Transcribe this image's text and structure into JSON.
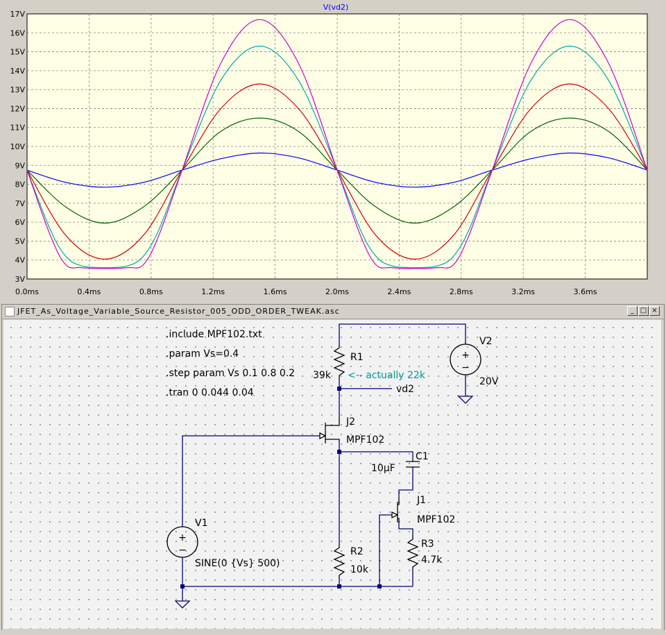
{
  "plot": {
    "trace_title": "V(vd2)",
    "trace_title_color": "#0000ff",
    "background": "#ffffe6",
    "grid_color": "#808080",
    "y_ticks": [
      "3V",
      "4V",
      "5V",
      "6V",
      "7V",
      "8V",
      "9V",
      "10V",
      "11V",
      "12V",
      "13V",
      "14V",
      "15V",
      "16V",
      "17V"
    ],
    "x_ticks": [
      "0.0ms",
      "0.4ms",
      "0.8ms",
      "1.2ms",
      "1.6ms",
      "2.0ms",
      "2.4ms",
      "2.8ms",
      "3.2ms",
      "3.6ms"
    ]
  },
  "chart_data": {
    "type": "line",
    "title": "V(vd2)",
    "x_unit": "ms",
    "y_unit": "V",
    "xlim": [
      0,
      4.0
    ],
    "ylim": [
      3,
      17
    ],
    "grid": true,
    "series": [
      {
        "color": "#0000ff",
        "x": [
          0,
          0.25,
          0.5,
          0.75,
          1.0,
          1.25,
          1.5,
          1.75,
          2.0,
          2.25,
          2.5,
          2.75,
          3.0,
          3.25,
          3.5,
          3.75,
          4.0
        ],
        "y": [
          8.75,
          8.1,
          7.85,
          8.1,
          8.75,
          9.35,
          9.65,
          9.4,
          8.75,
          8.1,
          7.85,
          8.1,
          8.75,
          9.35,
          9.65,
          9.4,
          8.75
        ]
      },
      {
        "color": "#006400",
        "x": [
          0,
          0.25,
          0.5,
          0.75,
          1.0,
          1.25,
          1.5,
          1.75,
          2.0,
          2.25,
          2.5,
          2.75,
          3.0,
          3.25,
          3.5,
          3.75,
          4.0
        ],
        "y": [
          8.75,
          6.8,
          5.95,
          6.8,
          8.75,
          10.8,
          11.5,
          10.8,
          8.75,
          6.8,
          5.95,
          6.8,
          8.75,
          10.8,
          11.5,
          10.8,
          8.75
        ]
      },
      {
        "color": "#cc0000",
        "x": [
          0,
          0.25,
          0.5,
          0.75,
          1.0,
          1.25,
          1.5,
          1.75,
          2.0,
          2.25,
          2.5,
          2.75,
          3.0,
          3.25,
          3.5,
          3.75,
          4.0
        ],
        "y": [
          8.75,
          5.3,
          4.05,
          5.3,
          8.75,
          12.0,
          13.3,
          12.0,
          8.75,
          5.3,
          4.05,
          5.3,
          8.75,
          12.0,
          13.3,
          12.0,
          8.75
        ]
      },
      {
        "color": "#00aaaa",
        "x": [
          0,
          0.15,
          0.25,
          0.35,
          0.5,
          0.65,
          0.75,
          0.85,
          1.0,
          1.25,
          1.5,
          1.75,
          2.0,
          2.15,
          2.25,
          2.35,
          2.5,
          2.65,
          2.75,
          2.85,
          3.0,
          3.25,
          3.5,
          3.75,
          4.0
        ],
        "y": [
          8.75,
          5.6,
          4.2,
          3.7,
          3.6,
          3.7,
          4.2,
          5.6,
          8.75,
          13.5,
          15.3,
          13.5,
          8.75,
          5.6,
          4.2,
          3.7,
          3.6,
          3.7,
          4.2,
          5.6,
          8.75,
          13.5,
          15.3,
          13.5,
          8.75
        ]
      },
      {
        "color": "#cc00cc",
        "x": [
          0,
          0.15,
          0.25,
          0.35,
          0.5,
          0.65,
          0.75,
          0.85,
          1.0,
          1.25,
          1.5,
          1.75,
          2.0,
          2.15,
          2.25,
          2.35,
          2.5,
          2.65,
          2.75,
          2.85,
          3.0,
          3.25,
          3.5,
          3.75,
          4.0
        ],
        "y": [
          8.75,
          5.3,
          3.75,
          3.6,
          3.55,
          3.6,
          3.75,
          5.3,
          8.75,
          14.4,
          16.7,
          14.4,
          8.75,
          5.3,
          3.75,
          3.6,
          3.55,
          3.6,
          3.75,
          5.3,
          8.75,
          14.4,
          16.7,
          14.4,
          8.75
        ]
      }
    ]
  },
  "window": {
    "title": "JFET_As_Voltage_Variable_Source_Resistor_005_ODD_ORDER_TWEAK.asc",
    "minimize_label": "_",
    "maximize_label": "□",
    "close_label": "×"
  },
  "schematic": {
    "directives": [
      ".include MPF102.txt",
      ".param Vs=0.4",
      ".step param Vs 0.1 0.8 0.2",
      ".tran 0 0.044 0.04"
    ],
    "r1_name": "R1",
    "r1_value": "39k",
    "r1_comment": "<-- actually 22k",
    "r1_comment_color": "#009999",
    "v2_name": "V2",
    "v2_value": "20V",
    "net_label": "vd2",
    "j2_name": "J2",
    "j2_model": "MPF102",
    "c1_name": "C1",
    "c1_value": "10µF",
    "j1_name": "J1",
    "j1_model": "MPF102",
    "v1_name": "V1",
    "v1_value": "SINE(0 {Vs} 500)",
    "r2_name": "R2",
    "r2_value": "10k",
    "r3_name": "R3",
    "r3_value": "4.7k",
    "wire_color": "#000080",
    "plus_sign": "+",
    "minus_sign": "−"
  }
}
